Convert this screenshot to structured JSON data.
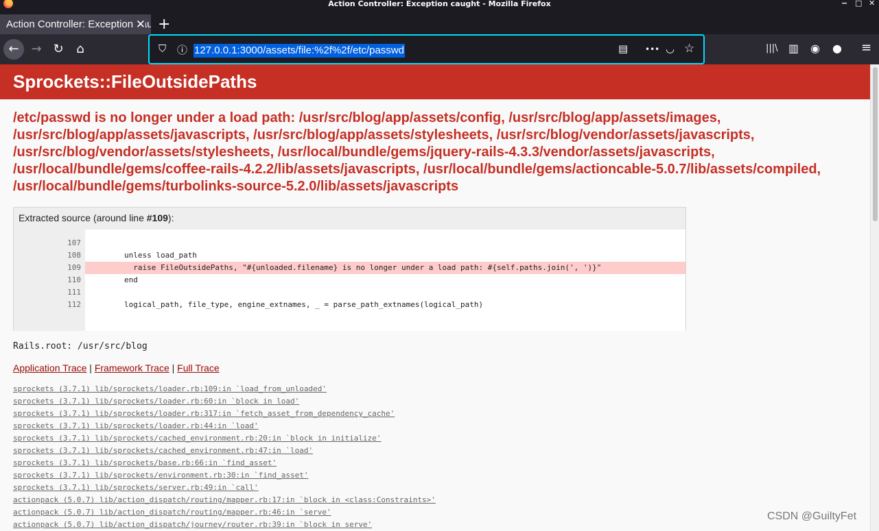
{
  "window": {
    "title": "Action Controller: Exception caught - Mozilla Firefox",
    "controls": [
      "−",
      "□",
      "✕"
    ]
  },
  "tab": {
    "title": "Action Controller: Exception caught",
    "close_glyph": "✕",
    "new_tab_glyph": "+"
  },
  "nav": {
    "back_glyph": "←",
    "forward_glyph": "→",
    "reload_glyph": "↻",
    "home_glyph": "⌂",
    "url": "127.0.0.1:3000/assets/file:%2f%2f/etc/passwd",
    "shield_glyph": "⛉",
    "info_glyph": "ⓘ",
    "reader_glyph": "▤",
    "more_glyph": "•••",
    "pocket_glyph": "◡",
    "star_glyph": "☆",
    "library_glyph": "|||\\",
    "sidebar_glyph": "▥",
    "account_glyph": "◉",
    "ext_glyph": "●",
    "menu_glyph": "≡"
  },
  "page": {
    "header_title": "Sprockets::FileOutsidePaths",
    "message": "/etc/passwd is no longer under a load path: /usr/src/blog/app/assets/config, /usr/src/blog/app/assets/images, /usr/src/blog/app/assets/javascripts, /usr/src/blog/app/assets/stylesheets, /usr/src/blog/vendor/assets/javascripts, /usr/src/blog/vendor/assets/stylesheets, /usr/local/bundle/gems/jquery-rails-4.3.3/vendor/assets/javascripts, /usr/local/bundle/gems/coffee-rails-4.2.2/lib/assets/javascripts, /usr/local/bundle/gems/actioncable-5.0.7/lib/assets/compiled, /usr/local/bundle/gems/turbolinks-source-5.2.0/lib/assets/javascripts",
    "source": {
      "label_prefix": "Extracted source (around line ",
      "line_ref": "#109",
      "label_suffix": "):",
      "line_numbers": [
        "107",
        "108",
        "109",
        "110",
        "111",
        "112"
      ],
      "code_lines": [
        "",
        "        unless load_path",
        "          raise FileOutsidePaths, \"#{unloaded.filename} is no longer under a load path: #{self.paths.join(', ')}\"",
        "        end",
        "",
        "        logical_path, file_type, engine_extnames, _ = parse_path_extnames(logical_path)"
      ]
    },
    "rails_root": "Rails.root: /usr/src/blog",
    "trace_links": {
      "application": "Application Trace",
      "framework": "Framework Trace",
      "full": "Full Trace",
      "separator": "|"
    },
    "frames": [
      "sprockets (3.7.1) lib/sprockets/loader.rb:109:in `load_from_unloaded'",
      "sprockets (3.7.1) lib/sprockets/loader.rb:60:in `block in load'",
      "sprockets (3.7.1) lib/sprockets/loader.rb:317:in `fetch_asset_from_dependency_cache'",
      "sprockets (3.7.1) lib/sprockets/loader.rb:44:in `load'",
      "sprockets (3.7.1) lib/sprockets/cached_environment.rb:20:in `block in initialize'",
      "sprockets (3.7.1) lib/sprockets/cached_environment.rb:47:in `load'",
      "sprockets (3.7.1) lib/sprockets/base.rb:66:in `find_asset'",
      "sprockets (3.7.1) lib/sprockets/environment.rb:30:in `find_asset'",
      "sprockets (3.7.1) lib/sprockets/server.rb:49:in `call'",
      "actionpack (5.0.7) lib/action_dispatch/routing/mapper.rb:17:in `block in <class:Constraints>'",
      "actionpack (5.0.7) lib/action_dispatch/routing/mapper.rb:46:in `serve'",
      "actionpack (5.0.7) lib/action_dispatch/journey/router.rb:39:in `block in serve'"
    ],
    "watermark": "CSDN @GuiltyFet"
  }
}
